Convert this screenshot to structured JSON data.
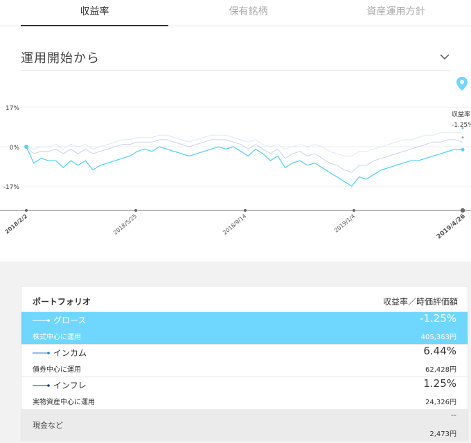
{
  "tabs": [
    "収益率",
    "保有銘柄",
    "資産運用方針"
  ],
  "period": {
    "label": "運用開始から"
  },
  "chart_data": {
    "type": "line",
    "y_ticks": [
      "17%",
      "0%",
      "-17%"
    ],
    "x_ticks": [
      "2018/2/2",
      "2018/5/25",
      "2018/9/14",
      "2019/1/4",
      "2019/4/26"
    ],
    "ylim": [
      -25,
      27
    ],
    "marker_label": "収益率",
    "marker_value": "-1.25%",
    "series": [
      {
        "name": "グロース",
        "color": "#5bd0f5",
        "values": [
          0,
          -7,
          -5,
          -6,
          -6,
          -9,
          -6,
          -8,
          -6,
          -10,
          -8,
          -7,
          -6,
          -5,
          -4,
          -2,
          -1,
          -2,
          0,
          -1,
          -2,
          -3,
          -4,
          -3,
          -2,
          -1,
          0,
          -1,
          0,
          -2,
          -4,
          -1,
          -3,
          -6,
          -4,
          -9,
          -7,
          -6,
          -8,
          -7,
          -9,
          -11,
          -13,
          -15,
          -17,
          -13,
          -14,
          -12,
          -10,
          -9,
          -8,
          -7,
          -6,
          -6,
          -5,
          -4,
          -3,
          -2,
          -1,
          -1.25
        ]
      },
      {
        "name": "インカム",
        "color": "#c9d4ea",
        "values": [
          0,
          -3,
          -2,
          -2,
          -1,
          -3,
          -1,
          -3,
          -1,
          -3,
          -2,
          -1,
          0,
          1,
          1,
          2,
          2,
          2,
          3,
          3,
          2,
          1,
          0,
          1,
          2,
          3,
          3,
          3,
          2,
          1,
          -1,
          1,
          -1,
          -3,
          -1,
          -5,
          -3,
          -2,
          -4,
          -3,
          -5,
          -7,
          -8,
          -10,
          -11,
          -8,
          -8,
          -6,
          -5,
          -4,
          -3,
          -2,
          -1,
          0,
          1,
          2,
          2,
          3,
          3,
          2
        ]
      },
      {
        "name": "インフレ",
        "color": "#e2e7f2",
        "values": [
          0,
          -1,
          0,
          0,
          1,
          -1,
          1,
          0,
          1,
          -1,
          0,
          1,
          2,
          3,
          3,
          4,
          4,
          4,
          5,
          5,
          4,
          3,
          2,
          3,
          4,
          5,
          5,
          5,
          4,
          3,
          2,
          3,
          1,
          0,
          1,
          -1,
          0,
          1,
          0,
          1,
          0,
          -2,
          -3,
          -4,
          -4,
          -2,
          -2,
          -1,
          0,
          1,
          2,
          3,
          3,
          4,
          5,
          5,
          6,
          6,
          6,
          6
        ]
      }
    ]
  },
  "card": {
    "header_left": "ポートフォリオ",
    "header_right": "収益率／時価評価額",
    "rows": [
      {
        "name": "グロース",
        "sub": "株式中心に運用",
        "rate": "-1.25%",
        "amount": "405,363円",
        "color": "#ffffff"
      },
      {
        "name": "インカム",
        "sub": "債券中心に運用",
        "rate": "6.44%",
        "amount": "62,428円",
        "color": "#1f7ac9"
      },
      {
        "name": "インフレ",
        "sub": "実物資産中心に運用",
        "rate": "1.25%",
        "amount": "24,326円",
        "color": "#1c3a8a"
      }
    ],
    "cash": {
      "name": "現金など",
      "rate": "--",
      "amount": "2,473円"
    }
  }
}
